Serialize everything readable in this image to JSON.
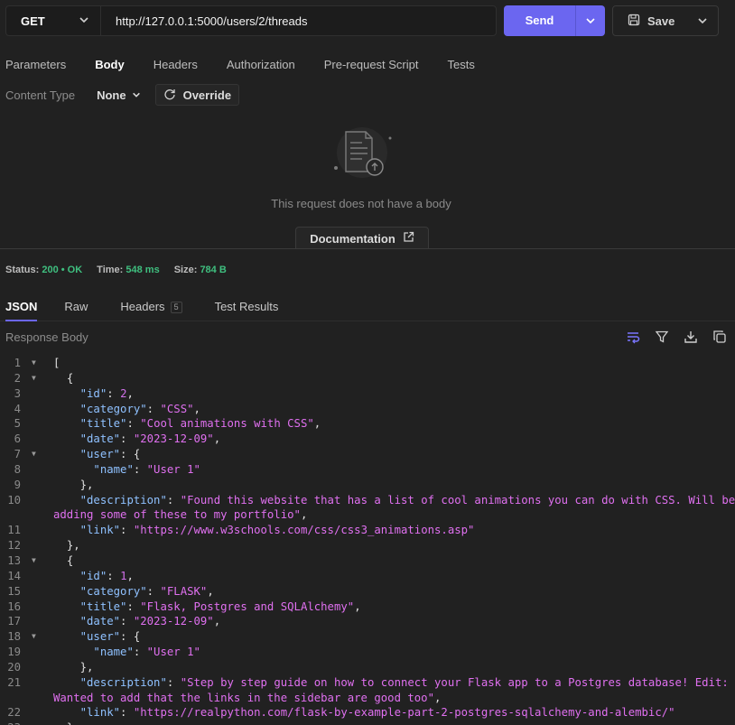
{
  "request": {
    "method": "GET",
    "url": "http://127.0.0.1:5000/users/2/threads",
    "send_label": "Send",
    "save_label": "Save"
  },
  "request_tabs": [
    "Parameters",
    "Body",
    "Headers",
    "Authorization",
    "Pre-request Script",
    "Tests"
  ],
  "active_request_tab": "Body",
  "body": {
    "content_type_label": "Content Type",
    "content_type_value": "None",
    "override_label": "Override",
    "empty_message": "This request does not have a body",
    "documentation_label": "Documentation"
  },
  "response": {
    "status_label": "Status:",
    "status_value": "200 • OK",
    "time_label": "Time:",
    "time_value": "548 ms",
    "size_label": "Size:",
    "size_value": "784 B",
    "tabs": [
      "JSON",
      "Raw",
      "Headers",
      "Test Results"
    ],
    "headers_count": "5",
    "body_label": "Response Body"
  },
  "code_lines": [
    {
      "n": "1",
      "fold": true,
      "indent": "",
      "parts": [
        [
          "t",
          "["
        ]
      ]
    },
    {
      "n": "2",
      "fold": true,
      "indent": "  ",
      "parts": [
        [
          "t",
          "{"
        ]
      ]
    },
    {
      "n": "3",
      "fold": false,
      "indent": "    ",
      "parts": [
        [
          "k",
          "\"id\""
        ],
        [
          "t",
          ": "
        ],
        [
          "n",
          "2"
        ],
        [
          "t",
          ","
        ]
      ]
    },
    {
      "n": "4",
      "fold": false,
      "indent": "    ",
      "parts": [
        [
          "k",
          "\"category\""
        ],
        [
          "t",
          ": "
        ],
        [
          "s",
          "\"CSS\""
        ],
        [
          "t",
          ","
        ]
      ]
    },
    {
      "n": "5",
      "fold": false,
      "indent": "    ",
      "parts": [
        [
          "k",
          "\"title\""
        ],
        [
          "t",
          ": "
        ],
        [
          "s",
          "\"Cool animations with CSS\""
        ],
        [
          "t",
          ","
        ]
      ]
    },
    {
      "n": "6",
      "fold": false,
      "indent": "    ",
      "parts": [
        [
          "k",
          "\"date\""
        ],
        [
          "t",
          ": "
        ],
        [
          "s",
          "\"2023-12-09\""
        ],
        [
          "t",
          ","
        ]
      ]
    },
    {
      "n": "7",
      "fold": true,
      "indent": "    ",
      "parts": [
        [
          "k",
          "\"user\""
        ],
        [
          "t",
          ": {"
        ]
      ]
    },
    {
      "n": "8",
      "fold": false,
      "indent": "      ",
      "parts": [
        [
          "k",
          "\"name\""
        ],
        [
          "t",
          ": "
        ],
        [
          "s",
          "\"User 1\""
        ]
      ]
    },
    {
      "n": "9",
      "fold": false,
      "indent": "    ",
      "parts": [
        [
          "t",
          "},"
        ]
      ]
    },
    {
      "n": "10",
      "fold": false,
      "indent": "    ",
      "parts": [
        [
          "k",
          "\"description\""
        ],
        [
          "t",
          ": "
        ],
        [
          "s",
          "\"Found this website that has a list of cool animations you can do with CSS. Will be"
        ]
      ]
    },
    {
      "n": "",
      "fold": false,
      "indent": "",
      "parts": [
        [
          "s",
          "adding some of these to my portfolio\""
        ],
        [
          "t",
          ","
        ]
      ]
    },
    {
      "n": "11",
      "fold": false,
      "indent": "    ",
      "parts": [
        [
          "k",
          "\"link\""
        ],
        [
          "t",
          ": "
        ],
        [
          "s",
          "\"https://www.w3schools.com/css/css3_animations.asp\""
        ]
      ]
    },
    {
      "n": "12",
      "fold": false,
      "indent": "  ",
      "parts": [
        [
          "t",
          "},"
        ]
      ]
    },
    {
      "n": "13",
      "fold": true,
      "indent": "  ",
      "parts": [
        [
          "t",
          "{"
        ]
      ]
    },
    {
      "n": "14",
      "fold": false,
      "indent": "    ",
      "parts": [
        [
          "k",
          "\"id\""
        ],
        [
          "t",
          ": "
        ],
        [
          "n",
          "1"
        ],
        [
          "t",
          ","
        ]
      ]
    },
    {
      "n": "15",
      "fold": false,
      "indent": "    ",
      "parts": [
        [
          "k",
          "\"category\""
        ],
        [
          "t",
          ": "
        ],
        [
          "s",
          "\"FLASK\""
        ],
        [
          "t",
          ","
        ]
      ]
    },
    {
      "n": "16",
      "fold": false,
      "indent": "    ",
      "parts": [
        [
          "k",
          "\"title\""
        ],
        [
          "t",
          ": "
        ],
        [
          "s",
          "\"Flask, Postgres and SQLAlchemy\""
        ],
        [
          "t",
          ","
        ]
      ]
    },
    {
      "n": "17",
      "fold": false,
      "indent": "    ",
      "parts": [
        [
          "k",
          "\"date\""
        ],
        [
          "t",
          ": "
        ],
        [
          "s",
          "\"2023-12-09\""
        ],
        [
          "t",
          ","
        ]
      ]
    },
    {
      "n": "18",
      "fold": true,
      "indent": "    ",
      "parts": [
        [
          "k",
          "\"user\""
        ],
        [
          "t",
          ": {"
        ]
      ]
    },
    {
      "n": "19",
      "fold": false,
      "indent": "      ",
      "parts": [
        [
          "k",
          "\"name\""
        ],
        [
          "t",
          ": "
        ],
        [
          "s",
          "\"User 1\""
        ]
      ]
    },
    {
      "n": "20",
      "fold": false,
      "indent": "    ",
      "parts": [
        [
          "t",
          "},"
        ]
      ]
    },
    {
      "n": "21",
      "fold": false,
      "indent": "    ",
      "parts": [
        [
          "k",
          "\"description\""
        ],
        [
          "t",
          ": "
        ],
        [
          "s",
          "\"Step by step guide on how to connect your Flask app to a Postgres database! Edit:"
        ]
      ]
    },
    {
      "n": "",
      "fold": false,
      "indent": "",
      "parts": [
        [
          "s",
          "Wanted to add that the links in the sidebar are good too\""
        ],
        [
          "t",
          ","
        ]
      ]
    },
    {
      "n": "22",
      "fold": false,
      "indent": "    ",
      "parts": [
        [
          "k",
          "\"link\""
        ],
        [
          "t",
          ": "
        ],
        [
          "s",
          "\"https://realpython.com/flask-by-example-part-2-postgres-sqlalchemy-and-alembic/\""
        ]
      ]
    },
    {
      "n": "23",
      "fold": false,
      "indent": "  ",
      "parts": [
        [
          "t",
          "}"
        ]
      ]
    }
  ],
  "colors": {
    "accent": "#6b66f0",
    "status_ok": "#3fbf7f",
    "json_key": "#8fc1ff",
    "json_string": "#e070f0"
  }
}
